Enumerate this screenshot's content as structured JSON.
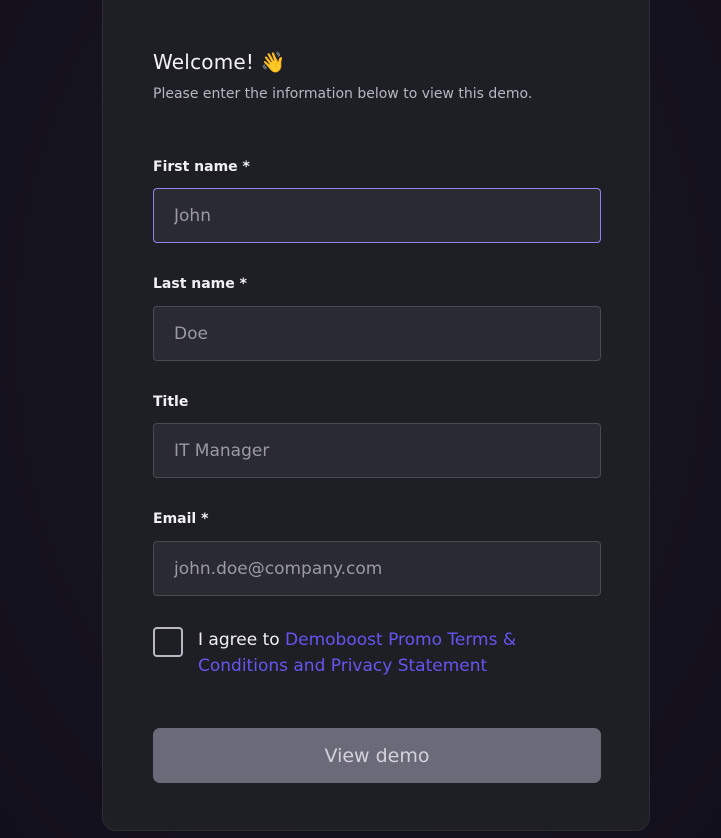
{
  "form": {
    "welcome_text": "Welcome!",
    "welcome_emoji": "👋",
    "subtitle": "Please enter the information below to view this demo.",
    "fields": [
      {
        "label": "First name *",
        "placeholder": "John",
        "value": ""
      },
      {
        "label": "Last name *",
        "placeholder": "Doe",
        "value": ""
      },
      {
        "label": "Title",
        "placeholder": "IT Manager",
        "value": ""
      },
      {
        "label": "Email *",
        "placeholder": "john.doe@company.com",
        "value": ""
      }
    ],
    "agree_prefix": "I agree to ",
    "terms_link": "Demoboost Promo Terms & Conditions and Privacy Statement",
    "agree_checked": false,
    "submit_label": "View demo"
  },
  "colors": {
    "background": "#16141f",
    "card": "#1e1e25",
    "input_bg": "#2a2a33",
    "focus_border": "#8c84e8",
    "link": "#6456f0",
    "button_disabled": "#6b6a79"
  },
  "icons": {
    "welcome": "waving-hand-icon"
  }
}
